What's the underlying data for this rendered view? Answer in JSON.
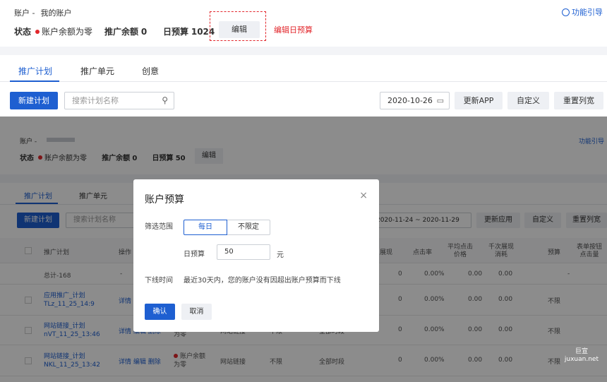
{
  "top": {
    "account_label": "账户 -",
    "account_name": "我的账户",
    "help": "功能引导",
    "status_label": "状态",
    "status_value": "账户余额为零",
    "balance_label": "推广余额",
    "balance_value": "0",
    "budget_label": "日预算",
    "budget_value": "1024",
    "edit_button": "编辑",
    "annotation": "编辑日预算",
    "tabs": [
      "推广计划",
      "推广单元",
      "创意"
    ],
    "new_plan": "新建计划",
    "search_placeholder": "搜索计划名称",
    "date": "2020-10-26",
    "update_app": "更新APP",
    "customize": "自定义",
    "reset_cols": "重置列宽"
  },
  "bottom": {
    "account_label": "账户 -",
    "help": "功能引导",
    "status_label": "状态",
    "status_value": "账户余额为零",
    "balance_label": "推广余额",
    "balance_value": "0",
    "budget_label": "日预算",
    "budget_value": "50",
    "edit_button": "编辑",
    "tabs": [
      "推广计划",
      "推广单元"
    ],
    "new_plan": "新建计划",
    "search_placeholder": "搜索计划名称",
    "date_range": "2020-11-24 ~ 2020-11-29",
    "update_app": "更新应用",
    "customize": "自定义",
    "reset_cols": "重置列宽",
    "columns": {
      "plan": "推广计划",
      "ops": "操作",
      "show": "展现",
      "ctr": "点击率",
      "avg_click": "平均点击价格",
      "cpm": "千次展现消耗",
      "budget": "预算",
      "cost_per": "表单按钮点击量"
    },
    "total": "总计-168",
    "total_dash": "-",
    "rows": [
      {
        "name": "应用推广_计划TLz_11_25_14:9",
        "ops": "详情",
        "show": "0",
        "ctr": "0.00%",
        "avg": "0.00",
        "cpm": "0.00",
        "budget": "不限"
      },
      {
        "name": "网站链接_计划nVT_11_25_13:46",
        "ops": "详情 编辑 删除",
        "show": "0",
        "ctr": "0.00%",
        "avg": "0.00",
        "cpm": "0.00",
        "budget": "不限",
        "status": "账户余额为零",
        "type": "网站链接",
        "limit": "不限",
        "period": "全部时段"
      },
      {
        "name": "网站链接_计划NKL_11_25_13:42",
        "ops": "详情 编辑 删除",
        "show": "0",
        "ctr": "0.00%",
        "avg": "0.00",
        "cpm": "0.00",
        "budget": "不限",
        "status": "账户余额为零",
        "type": "网站链接",
        "limit": "不限",
        "period": "全部时段"
      }
    ],
    "row_zero": "0",
    "row_zero_pct": "0.00%",
    "total_zero": "0",
    "total_pct": "0.00%",
    "total_avg": "0.00",
    "total_cpm": "0.00"
  },
  "modal": {
    "title": "账户预算",
    "close": "×",
    "filter_label": "筛选范围",
    "seg_daily": "每日",
    "seg_unlimited": "不限定",
    "daily_budget_label": "日预算",
    "daily_budget_value": "50",
    "unit": "元",
    "offline_label": "下线时间",
    "offline_text": "最近30天内，您的账户没有因超出账户预算而下线",
    "confirm": "确认",
    "cancel": "取消"
  },
  "watermark": {
    "line1": "巨宣",
    "line2": "juxuan.net"
  }
}
